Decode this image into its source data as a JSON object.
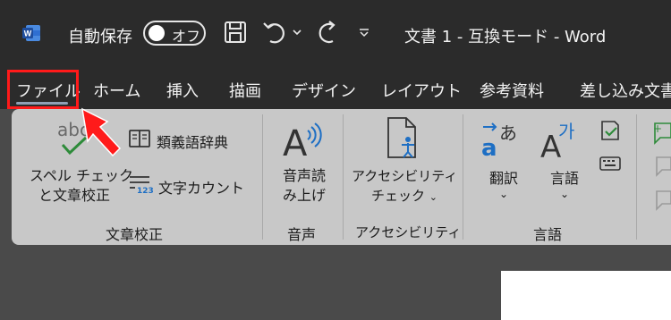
{
  "titlebar": {
    "autosave_label": "自動保存",
    "autosave_state": "オフ",
    "document_title": "文書 1  -  互換モード  -  Word",
    "save_icon": "save-icon",
    "undo_icon": "undo-icon",
    "redo_icon": "redo-icon",
    "qat_icon": "customize-quick-access-icon"
  },
  "tabs": [
    "ファイル",
    "ホーム",
    "挿入",
    "描画",
    "デザイン",
    "レイアウト",
    "参考資料",
    "差し込み文書"
  ],
  "ribbon": {
    "proofing": {
      "spell_check_line1": "スペル チェック",
      "spell_check_line2": "と文章校正",
      "thesaurus": "類義語辞典",
      "word_count": "文字カウント",
      "group_label": "文章校正"
    },
    "speech": {
      "read_aloud_line1": "音声読",
      "read_aloud_line2": "み上げ",
      "group_label": "音声"
    },
    "accessibility": {
      "check_line1": "アクセシビリティ",
      "check_line2": "チェック",
      "group_label": "アクセシビリティ"
    },
    "language": {
      "translate": "翻訳",
      "language": "言語",
      "group_label": "言語"
    }
  },
  "colors": {
    "titlebar_bg": "#2b2b2b",
    "ribbon_bg": "#c8c8c8",
    "highlight": "#ff1a1a",
    "arrow": "#ff1a1a",
    "word_blue": "#2b5fb4",
    "language_blue": "#1e6fc4"
  }
}
